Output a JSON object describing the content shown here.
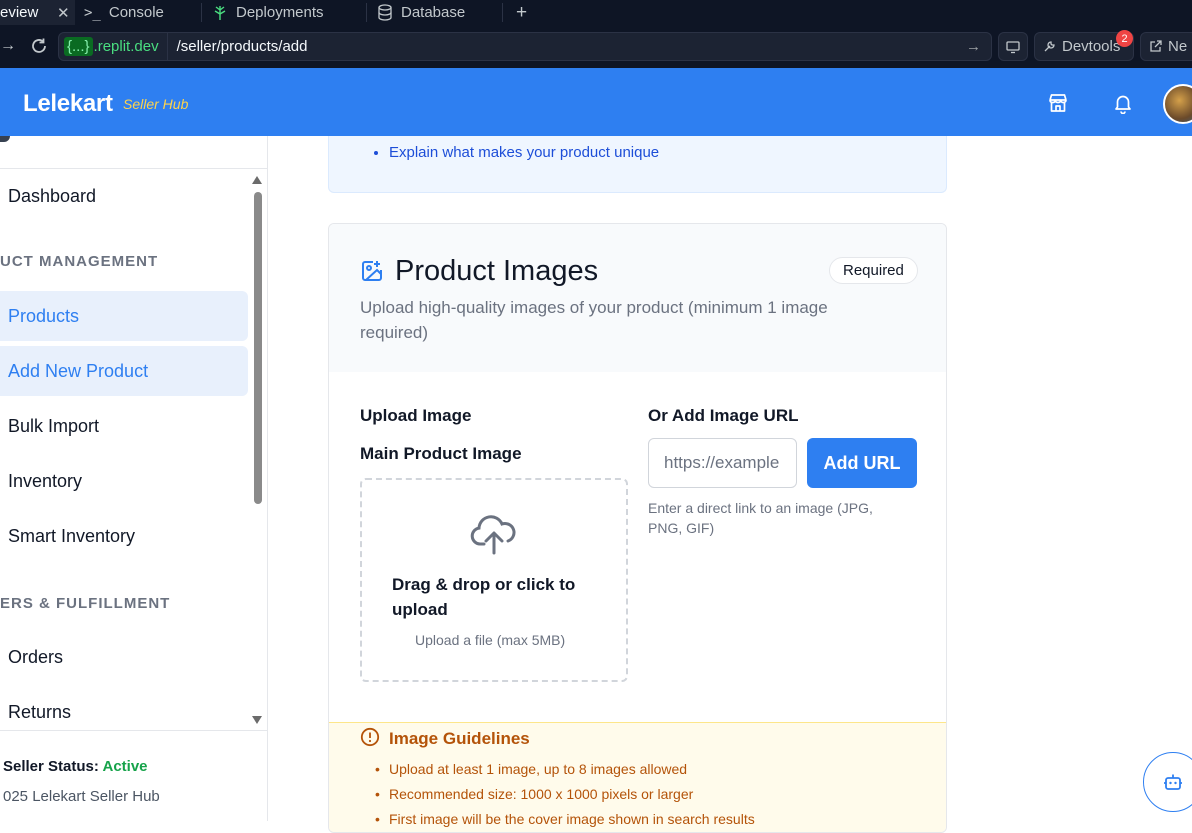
{
  "replit": {
    "tabs": [
      {
        "label": "eview",
        "active": true
      },
      {
        "label": "Console"
      },
      {
        "label": "Deployments"
      },
      {
        "label": "Database"
      }
    ],
    "url_host": ".replit.dev",
    "url_host_chip": "{...}",
    "url_path": "/seller/products/add",
    "devtools_label": "Devtools",
    "devtools_badge": "2",
    "new_tab_label": "Ne"
  },
  "header": {
    "logo": "Lelekart",
    "logo_sub": "Seller Hub"
  },
  "sidebar": {
    "items": [
      {
        "label": "Dashboard"
      },
      {
        "label": "Products"
      },
      {
        "label": "Add New Product"
      },
      {
        "label": "Bulk Import"
      },
      {
        "label": "Inventory"
      },
      {
        "label": "Smart Inventory"
      },
      {
        "label": "Orders"
      },
      {
        "label": "Returns"
      }
    ],
    "sections": [
      "UCT MANAGEMENT",
      "ERS & FULFILLMENT"
    ],
    "status_label": "Seller Status:",
    "status_value": "Active",
    "copyright": "025 Lelekart Seller Hub"
  },
  "main": {
    "tip": "Explain what makes your product unique",
    "card_title": "Product Images",
    "badge": "Required",
    "card_sub": "Upload high-quality images of your product (minimum 1 image required)",
    "upload_label": "Upload Image",
    "main_image_label": "Main Product Image",
    "dropzone_text": "Drag & drop or click to upload",
    "dropzone_hint": "Upload a file (max 5MB)",
    "url_label": "Or Add Image URL",
    "url_placeholder": "https://example",
    "add_url_button": "Add URL",
    "url_help": "Enter a direct link to an image (JPG, PNG, GIF)",
    "guidelines_title": "Image Guidelines",
    "guidelines": [
      "Upload at least 1 image, up to 8 images allowed",
      "Recommended size: 1000 x 1000 pixels or larger",
      "First image will be the cover image shown in search results"
    ]
  },
  "colors": {
    "primary": "#2e7ff1",
    "accent_yellow": "#fcd34d",
    "success": "#16a34a",
    "warning": "#b45309"
  }
}
